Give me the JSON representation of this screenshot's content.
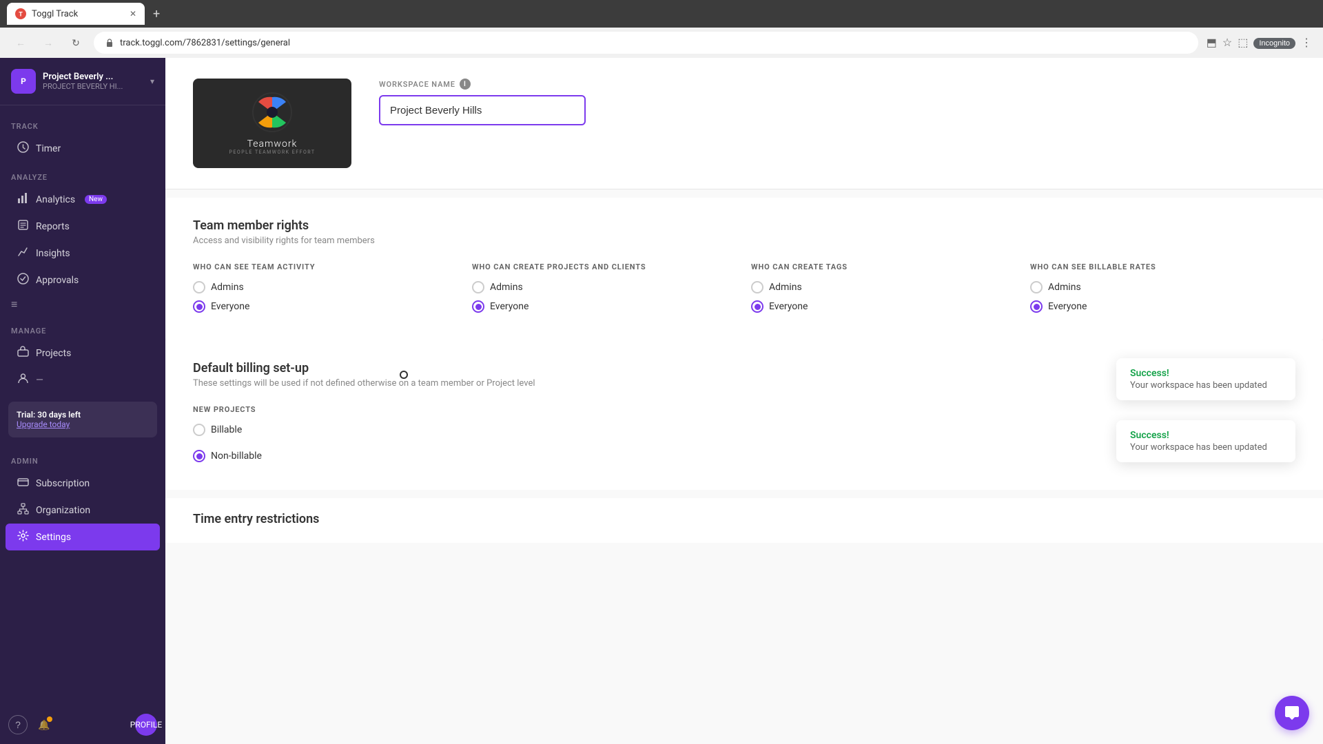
{
  "browser": {
    "tab_title": "Toggl Track",
    "tab_favicon": "T",
    "url": "track.toggl.com/7862831/settings/general",
    "new_tab": "+",
    "nav": {
      "back": "←",
      "forward": "→",
      "refresh": "↻"
    },
    "incognito": "Incognito"
  },
  "sidebar": {
    "workspace_name": "Project Beverly ...",
    "workspace_sub": "PROJECT BEVERLY HI...",
    "chevron": "▾",
    "track_label": "TRACK",
    "timer_label": "Timer",
    "analyze_label": "ANALYZE",
    "analytics_label": "Analytics",
    "analytics_badge": "New",
    "reports_label": "Reports",
    "insights_label": "Insights",
    "approvals_label": "Approvals",
    "manage_label": "MANAGE",
    "projects_label": "Projects",
    "clients_label": "...",
    "collapse_icon": "≡",
    "trial_text": "Trial: 30 days left",
    "upgrade_text": "Upgrade today",
    "admin_label": "ADMIN",
    "subscription_label": "Subscription",
    "organization_label": "Organization",
    "settings_label": "Settings",
    "profile_label": "PROFILE",
    "help_icon": "?",
    "bell_icon": "🔔"
  },
  "settings": {
    "workspace_name_label": "WORKSPACE NAME",
    "workspace_name_value": "Project Beverly Hills",
    "workspace_name_placeholder": "Project Beverly Hills",
    "info_icon": "i",
    "team_rights_title": "Team member rights",
    "team_rights_desc": "Access and visibility rights for team members",
    "cols": [
      {
        "label": "WHO CAN SEE TEAM ACTIVITY",
        "options": [
          {
            "label": "Admins",
            "checked": false
          },
          {
            "label": "Everyone",
            "checked": true
          }
        ]
      },
      {
        "label": "WHO CAN CREATE PROJECTS AND CLIENTS",
        "options": [
          {
            "label": "Admins",
            "checked": false
          },
          {
            "label": "Everyone",
            "checked": true
          }
        ]
      },
      {
        "label": "WHO CAN CREATE TAGS",
        "options": [
          {
            "label": "Admins",
            "checked": false
          },
          {
            "label": "Everyone",
            "checked": true
          }
        ]
      },
      {
        "label": "WHO CAN SEE BILLABLE RATES",
        "options": [
          {
            "label": "Admins",
            "checked": false
          },
          {
            "label": "Everyone",
            "checked": true
          }
        ]
      }
    ],
    "billing_title": "Default billing set-up",
    "billing_desc": "These settings will be used if not defined otherwise on a team member or Project level",
    "new_projects_label": "NEW PROJECTS",
    "new_projects_options": [
      {
        "label": "Billable",
        "checked": false
      },
      {
        "label": "Non-billable",
        "checked": true
      }
    ],
    "time_restrictions_title": "Time entry restrictions",
    "success1_title": "Success!",
    "success1_desc": "Your workspace has been updated",
    "success2_title": "Success!",
    "success2_desc": "Your workspace has been updated"
  }
}
